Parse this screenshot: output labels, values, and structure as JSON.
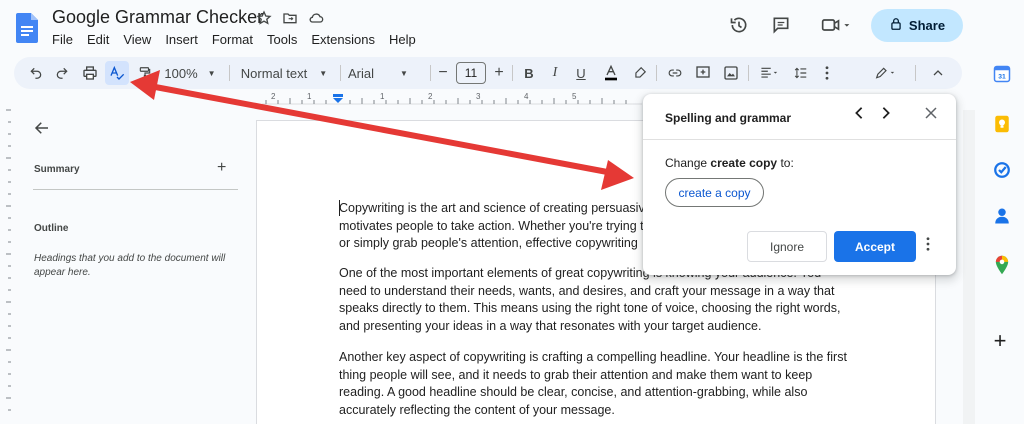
{
  "app": {
    "doc_title": "Google Grammar Checker",
    "menu": [
      "File",
      "Edit",
      "View",
      "Insert",
      "Format",
      "Tools",
      "Extensions",
      "Help"
    ],
    "share_label": "Share"
  },
  "toolbar": {
    "zoom": "100%",
    "style": "Normal text",
    "font": "Arial",
    "font_size": "11"
  },
  "ruler": {
    "labels": [
      "2",
      "1",
      "1",
      "2",
      "3",
      "4",
      "5"
    ]
  },
  "outline_panel": {
    "summary_label": "Summary",
    "outline_label": "Outline",
    "outline_hint": "Headings that you add to the document will appear here."
  },
  "document": {
    "paragraphs": [
      [
        "Copywriting is the art and science of creating persuasive",
        "motivates people to take action. Whether you're trying t",
        "or simply grab people's attention, effective copywriting"
      ],
      [
        "One of the most important elements of great copywriting is knowing your audience. You",
        "need to understand their needs, wants, and desires, and craft your message in a way that",
        "speaks directly to them. This means using the right tone of voice, choosing the right words,",
        "and presenting your ideas in a way that resonates with your target audience."
      ],
      [
        "Another key aspect of copywriting is crafting a compelling headline. Your headline is the first",
        "thing people will see, and it needs to grab their attention and make them want to keep",
        "reading. A good headline should be clear, concise, and attention-grabbing, while also",
        "accurately reflecting the content of your message."
      ]
    ]
  },
  "spelling_card": {
    "title": "Spelling and grammar",
    "change_prefix": "Change",
    "change_word": "create copy",
    "change_suffix": "to:",
    "suggestion": "create a copy",
    "ignore_label": "Ignore",
    "accept_label": "Accept"
  },
  "colors": {
    "accent": "#1a73e8",
    "share_bg": "#c2e7ff",
    "arrow": "#e53935"
  }
}
